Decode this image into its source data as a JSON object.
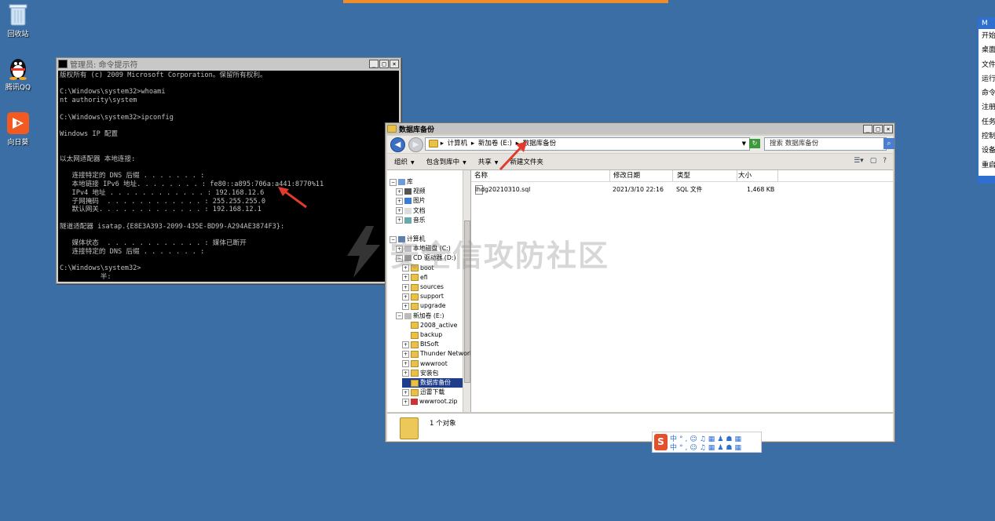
{
  "desktop": {
    "icons": [
      {
        "label": "回收站"
      },
      {
        "label": "腾讯QQ"
      },
      {
        "label": "向日葵"
      }
    ]
  },
  "cmd": {
    "title": "管理员: 命令提示符",
    "lines": [
      "版权所有 (c) 2009 Microsoft Corporation。保留所有权利。",
      "",
      "C:\\Windows\\system32>whoami",
      "nt authority\\system",
      "",
      "C:\\Windows\\system32>ipconfig",
      "",
      "Windows IP 配置",
      "",
      "",
      "以太网适配器 本地连接:",
      "",
      "   连接特定的 DNS 后缀 . . . . . . . :",
      "   本地链接 IPv6 地址. . . . . . . . : fe80::a895:706a:a441:8770%11",
      "   IPv4 地址 . . . . . . . . . . . . : 192.168.12.6",
      "   子网掩码  . . . . . . . . . . . . : 255.255.255.0",
      "   默认网关. . . . . . . . . . . . . : 192.168.12.1",
      "",
      "隧道适配器 isatap.{E8E3A393-2099-435E-BD99-A294AE3874F3}:",
      "",
      "   媒体状态  . . . . . . . . . . . . : 媒体已断开",
      "   连接特定的 DNS 后缀 . . . . . . . :",
      "",
      "C:\\Windows\\system32>",
      "          半:"
    ]
  },
  "explorer": {
    "title": "数据库备份",
    "address": {
      "crumbs": [
        "计算机",
        "新加卷 (E:)",
        "数据库备份"
      ]
    },
    "search_placeholder": "搜索 数据库备份",
    "toolbar": {
      "organize": "组织",
      "include": "包含到库中",
      "share": "共享",
      "new_folder": "新建文件夹"
    },
    "tree": [
      {
        "label": "库",
        "kind": "lib"
      },
      {
        "label": "视频",
        "kind": "video"
      },
      {
        "label": "图片",
        "kind": "pic"
      },
      {
        "label": "文档",
        "kind": "doc"
      },
      {
        "label": "音乐",
        "kind": "music"
      },
      {
        "label": "计算机",
        "kind": "pc"
      },
      {
        "label": "本地磁盘 (C:)",
        "kind": "disk"
      },
      {
        "label": "CD 驱动器 (D:)",
        "kind": "cd"
      },
      {
        "label": "boot",
        "kind": "folder"
      },
      {
        "label": "efi",
        "kind": "folder"
      },
      {
        "label": "sources",
        "kind": "folder"
      },
      {
        "label": "support",
        "kind": "folder"
      },
      {
        "label": "upgrade",
        "kind": "folder"
      },
      {
        "label": "新加卷 (E:)",
        "kind": "disk"
      },
      {
        "label": "2008_active",
        "kind": "folder"
      },
      {
        "label": "backup",
        "kind": "folder"
      },
      {
        "label": "BtSoft",
        "kind": "folder"
      },
      {
        "label": "Thunder Network",
        "kind": "folder"
      },
      {
        "label": "wwwroot",
        "kind": "folder"
      },
      {
        "label": "安装包",
        "kind": "folder"
      },
      {
        "label": "数据库备份",
        "kind": "folder"
      },
      {
        "label": "迅雷下载",
        "kind": "folder"
      },
      {
        "label": "wwwroot.zip",
        "kind": "zip"
      }
    ],
    "columns": [
      "名称",
      "修改日期",
      "类型",
      "大小"
    ],
    "files": [
      {
        "name": "lhdg20210310.sql",
        "date": "2021/3/10 22:16",
        "type": "SQL 文件",
        "size": "1,468 KB"
      }
    ],
    "status": "1 个对象"
  },
  "watermark": "安全信攻防社区",
  "side_panel": {
    "header": "M",
    "items": [
      "开始",
      "桌面",
      "文件",
      "运行",
      "命令",
      "注册",
      "任务",
      "控制",
      "设备",
      "重启"
    ]
  },
  "ime": {
    "logo": "S",
    "row1": "中°,☺♫▦♟☗▦",
    "row2": "中°,☺♫▦♟☗▦"
  },
  "colors": {
    "desktop": "#3a6ea5",
    "selection": "#1f3d8a",
    "arrow": "#e23a2c",
    "accent_bar": "#f08c2a"
  }
}
